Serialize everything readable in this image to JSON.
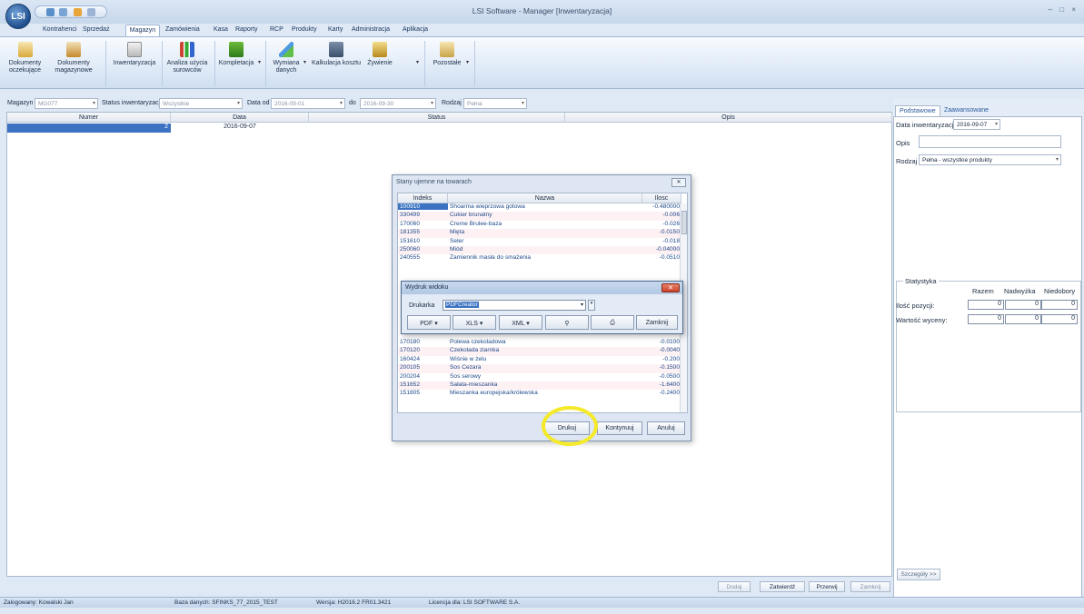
{
  "window": {
    "title": "LSI Software - Manager [Inwentaryzacja]",
    "logo": "LSI",
    "controls": "– □ ×"
  },
  "ribbon_tabs": [
    "Kontrahenci",
    "Sprzedaż",
    "Magazyn",
    "Zamówienia",
    "Kasa",
    "Raporty",
    "RCP",
    "Produkty",
    "Karty",
    "Administracja",
    "Aplikacja"
  ],
  "ribbon_buttons": {
    "dokumenty_oczekujace": "Dokumenty oczekujące",
    "dokumenty_magazynowe": "Dokumenty magazynowe",
    "inwentaryzacja": "Inwentaryzacja",
    "analiza": "Analiza użycia surowców",
    "kompletacja": "Kompletacja",
    "wymiana": "Wymiana danych",
    "kalkulacja": "Kalkulacja kosztu",
    "zywienie": "Żywienie",
    "pozostale": "Pozostałe"
  },
  "filters": {
    "magazyn_label": "Magazyn",
    "magazyn_value": "MG077",
    "status_label": "Status inwentaryzacji",
    "status_value": "Wszystkie",
    "data_od_label": "Data od",
    "data_od_value": "2016-09-01",
    "do_label": "do",
    "do_value": "2016-09-30",
    "rodzaj_label": "Rodzaj",
    "rodzaj_value": "Pełna"
  },
  "grid": {
    "columns": [
      "Numer",
      "Data",
      "Status",
      "Opis"
    ],
    "rows": [
      {
        "numer": "2",
        "data": "2016-09-07",
        "status": "",
        "opis": ""
      }
    ]
  },
  "right_panel": {
    "tabs": [
      "Podstawowe",
      "Zaawansowane"
    ],
    "data_inw_label": "Data inwentaryzacji",
    "data_inw_value": "2016-09-07",
    "opis_label": "Opis",
    "opis_value": "",
    "rodzaj_label": "Rodzaj",
    "rodzaj_value": "Pełna - wszystkie produkty",
    "stat_title": "Statystyka",
    "stat_cols": [
      "Razem",
      "Nadwyżka",
      "Niedobory"
    ],
    "stat_rows": [
      {
        "label": "Ilość pozycji:",
        "values": [
          "0",
          "0",
          "0"
        ]
      },
      {
        "label": "Wartość wyceny:",
        "values": [
          "0",
          "0",
          "0"
        ]
      }
    ],
    "details_button": "Szczegóły >>"
  },
  "bottom_buttons": {
    "dodaj": "Dodaj",
    "zatwierdz": "Zatwierdź",
    "przerwij": "Przerwij",
    "zamknij": "Zamknij"
  },
  "statusbar": {
    "user": "Zalogowany: Kowalski Jan",
    "db": "Baza danych: SFINKS_77_2015_TEST",
    "version": "Wersja: H2016.2 FR01.3421",
    "license": "Licencja dla: LSI SOFTWARE S.A."
  },
  "stock_dialog": {
    "title": "Stany ujemne na towarach",
    "columns": [
      "Indeks",
      "Nazwa",
      "Ilosc"
    ],
    "rows": [
      {
        "indeks": "100910",
        "nazwa": "Shoarma wieprzowa gotowa",
        "ilosc": "-0.480000"
      },
      {
        "indeks": "330499",
        "nazwa": "Cukier brunatny",
        "ilosc": "-0.006"
      },
      {
        "indeks": "170060",
        "nazwa": "Creme Brulee-baza",
        "ilosc": "-0.026"
      },
      {
        "indeks": "181355",
        "nazwa": "Mięta",
        "ilosc": "-0.0150"
      },
      {
        "indeks": "151610",
        "nazwa": "Seler",
        "ilosc": "-0.018"
      },
      {
        "indeks": "250060",
        "nazwa": "Miód",
        "ilosc": "-0.04000"
      },
      {
        "indeks": "240555",
        "nazwa": "Zamiennik masła do smażenia",
        "ilosc": "-0.0510"
      },
      {
        "indeks": "170180",
        "nazwa": "Polewa czekoladowa",
        "ilosc": "-0.0100"
      },
      {
        "indeks": "170120",
        "nazwa": "Czekolada ziarnka",
        "ilosc": "-0.0040"
      },
      {
        "indeks": "160424",
        "nazwa": "Wiśnie w żelu",
        "ilosc": "-0.200"
      },
      {
        "indeks": "200105",
        "nazwa": "Sos Cezara",
        "ilosc": "-0.1500"
      },
      {
        "indeks": "200204",
        "nazwa": "Sos serowy",
        "ilosc": "-0.0500"
      },
      {
        "indeks": "151652",
        "nazwa": "Sałata-mieszanka",
        "ilosc": "-1.6400"
      },
      {
        "indeks": "151805",
        "nazwa": "Mieszanka europejska/królewska",
        "ilosc": "-0.2400"
      }
    ],
    "buttons": {
      "drukuj": "Drukuj",
      "kontynuuj": "Kontynuuj",
      "anuluj": "Anuluj"
    }
  },
  "print_dialog": {
    "title": "Wydruk widoku",
    "printer_label": "Drukarka",
    "printer_value": "PDFCreator",
    "buttons": {
      "pdf": "PDF",
      "xls": "XLS",
      "xml": "XML",
      "zamknij": "Zamknij"
    }
  },
  "colors": {
    "selection": "#3b73c2",
    "highlight": "#f4ea2a",
    "accent": "#2b5a9a"
  }
}
